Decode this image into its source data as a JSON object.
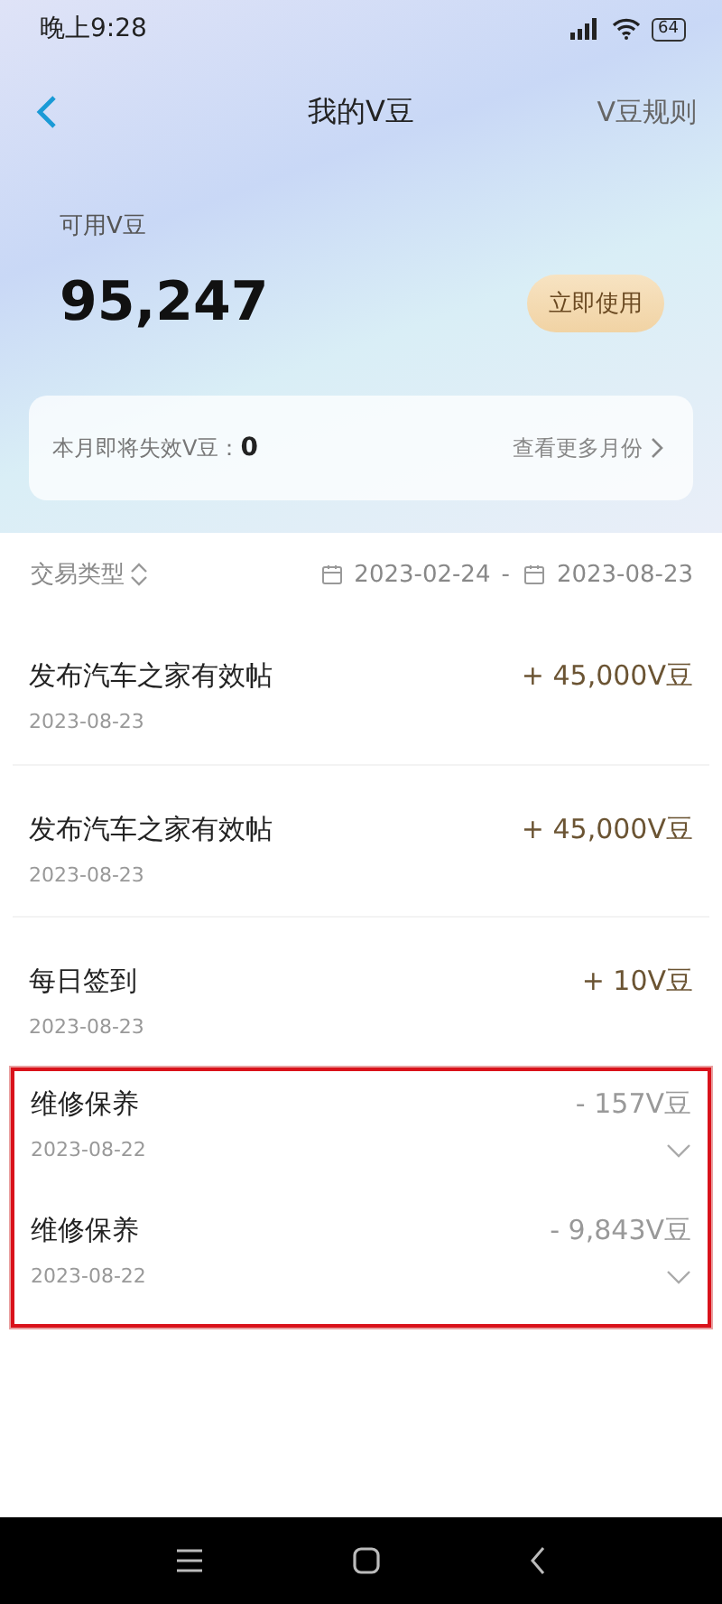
{
  "status_bar": {
    "time": "晚上9:28",
    "battery": "64"
  },
  "nav": {
    "title": "我的V豆",
    "action": "V豆规则"
  },
  "balance": {
    "label": "可用V豆",
    "value": "95,247",
    "button": "立即使用"
  },
  "expiring": {
    "label": "本月即将失效V豆：",
    "value": "0",
    "link": "查看更多月份"
  },
  "filter": {
    "type_label": "交易类型",
    "date_from": "2023-02-24",
    "separator": "-",
    "date_to": "2023-08-23"
  },
  "transactions": [
    {
      "title": "发布汽车之家有效帖",
      "date": "2023-08-23",
      "amount": "+ 45,000V豆",
      "kind": "credit",
      "expandable": false,
      "marked": false
    },
    {
      "title": "发布汽车之家有效帖",
      "date": "2023-08-23",
      "amount": "+ 45,000V豆",
      "kind": "credit",
      "expandable": false,
      "marked": false
    },
    {
      "title": "每日签到",
      "date": "2023-08-23",
      "amount": "+ 10V豆",
      "kind": "credit",
      "expandable": false,
      "marked": false
    },
    {
      "title": "维修保养",
      "date": "2023-08-22",
      "amount": "- 157V豆",
      "kind": "debit",
      "expandable": true,
      "marked": true
    },
    {
      "title": "维修保养",
      "date": "2023-08-22",
      "amount": "- 9,843V豆",
      "kind": "debit",
      "expandable": true,
      "marked": true
    }
  ]
}
